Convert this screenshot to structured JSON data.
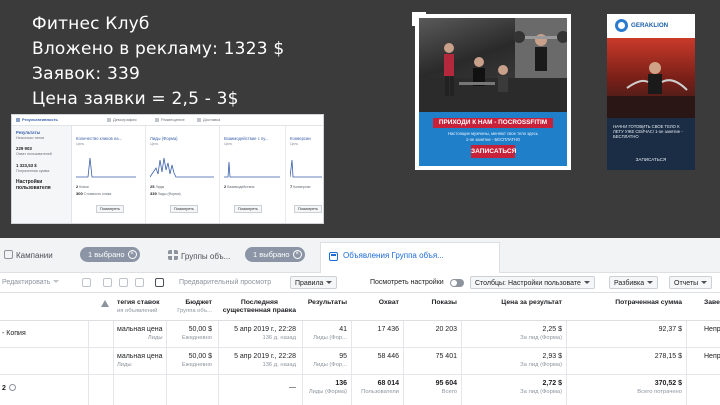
{
  "headline": {
    "line1": "Фитнес Клуб",
    "line2": "Вложено в рекламу: 1323 $",
    "line3": "Заявок: 339",
    "line4": "Цена заявки = 2,5 - 3$"
  },
  "mini_report": {
    "tabs": [
      "Результативность",
      "Демография",
      "Размещение",
      "Доставка"
    ],
    "left": {
      "title": "Результаты",
      "sub": "Несколько типов",
      "reach_value": "229 903",
      "reach_label": "Охват пользователей",
      "spend_value": "1 323,53 $",
      "spend_label": "Потраченная сумма",
      "settings_label": "Настройки пользователя"
    },
    "columns": [
      {
        "title": "Количество кликов на...",
        "sub": "Цель",
        "l1_value": "2",
        "l1_label": "Клики",
        "l2_value": "300",
        "l2_label": "Стоимость клика",
        "button": "Посмотреть"
      },
      {
        "title": "Лиды (Форма)",
        "sub": "Цель",
        "big": "25",
        "big_label": "Лиды",
        "l1_value": "339",
        "l1_label": "Лиды (Форма)",
        "button": "Посмотреть"
      },
      {
        "title": "Взаимодействие с пу...",
        "sub": "Цель",
        "l1_value": "2",
        "l1_label": "Взаимодействия",
        "button": "Посмотреть"
      },
      {
        "title": "Конверсии",
        "sub": "Цель",
        "l1_value": "7",
        "l1_label": "Конверсии",
        "button": "Посмотреть"
      }
    ]
  },
  "ad1": {
    "headline": "ПРИХОДИ К НАМ - ПОСROSSFITIM",
    "text1": "Настоящие мужчины, меняют свое тело здесь",
    "text2": "1-ое занятие - БЕСПЛАТНО",
    "cta": "ЗАПИСАТЬСЯ"
  },
  "ad2": {
    "logo": "GERAKLION",
    "text": "НАЧНИ ГОТОВИТЬ СВОЕ ТЕЛО К ЛЕТУ УЖЕ СЕЙЧАС! 1-ое занятие - БЕСПЛАТНО",
    "cta": "ЗАПИСАТЬСЯ"
  },
  "tabs": {
    "campaigns": "Кампании",
    "campaigns_selected": "1 выбрано",
    "adsets": "Группы объ...",
    "adsets_selected": "1 выбрано",
    "ads": "Объявления Группа объя..."
  },
  "toolbar": {
    "edit": "Редактировать",
    "preview": "Предварительный просмотр",
    "rules": "Правила",
    "view_settings": "Посмотреть настройки",
    "columns": "Столбцы: Настройки пользовате",
    "breakdown": "Разбивка",
    "reports": "Отчеты"
  },
  "table": {
    "headers": {
      "bid": "тегия ставок",
      "bid_sub": "ия объявлений",
      "budget": "Бюджет",
      "budget_sub": "Группа объ...",
      "edit": "Последняя",
      "edit2": "существенная правка",
      "results": "Результаты",
      "reach": "Охват",
      "impressions": "Показы",
      "cpr": "Цена за результат",
      "spent": "Потраченная сумма",
      "end": "Заве"
    },
    "rows": [
      {
        "name": "- Копия",
        "bid": "мальная цена",
        "bid_sub": "Лиды",
        "budget": "50,00 $",
        "budget_sub": "Ежедневно",
        "edit": "5 апр 2019 г., 22:28",
        "edit_sub": "136 д. назад",
        "results": "41",
        "results_sub": "Лиды (Фор...",
        "reach": "17 436",
        "impressions": "20 203",
        "cpr": "2,25 $",
        "cpr_sub": "За лид (Форма)",
        "spent": "92,37 $",
        "end": "Непре"
      },
      {
        "name": "",
        "bid": "мальная цена",
        "bid_sub": "Лиды",
        "budget": "50,00 $",
        "budget_sub": "Ежедневно",
        "edit": "5 апр 2019 г., 22:28",
        "edit_sub": "136 д. назад",
        "results": "95",
        "results_sub": "Лиды (Фор...",
        "reach": "58 446",
        "impressions": "75 401",
        "cpr": "2,93 $",
        "cpr_sub": "За лид (Форма)",
        "spent": "278,15 $",
        "end": "Непре"
      }
    ],
    "total": {
      "name": "2",
      "edit": "—",
      "results": "136",
      "results_sub": "Лиды (Форма)",
      "reach": "68 014",
      "reach_sub": "Пользователи",
      "impressions": "95 604",
      "impressions_sub": "Всего",
      "cpr": "2,72 $",
      "cpr_sub": "За лид (Форма)",
      "spent": "370,52 $",
      "spent_sub": "Всего потрачено"
    }
  }
}
